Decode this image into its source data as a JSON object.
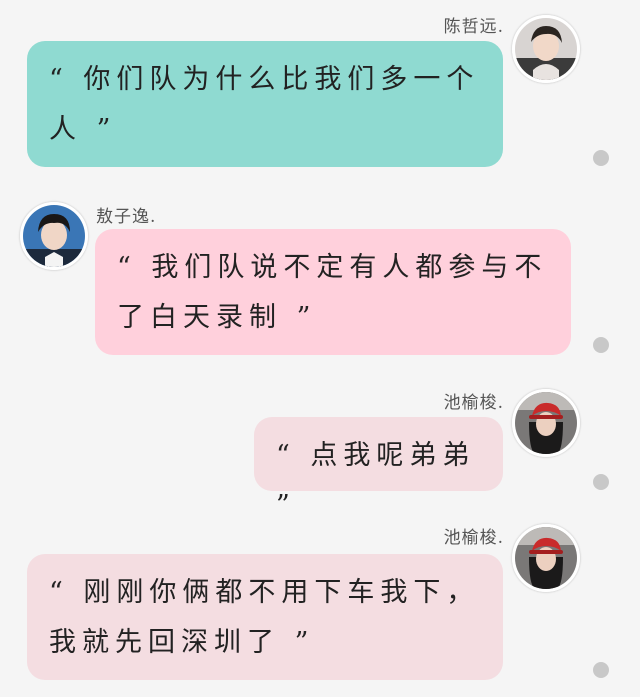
{
  "colors": {
    "background": "#f5f5f5",
    "teal_bubble": "#8fdad1",
    "pink_bubble": "#ffd0dc",
    "light_pink_bubble": "#f4dde1",
    "dot": "#c8c8c8"
  },
  "messages": [
    {
      "sender": "陈哲远.",
      "side": "right",
      "text": "“ 你们队为什么比我们多一个人 ”",
      "avatar_icon": "male-avatar-icon"
    },
    {
      "sender": "敖子逸.",
      "side": "left",
      "text": "“ 我们队说不定有人都参与不了白天录制 ”",
      "avatar_icon": "male-avatar-icon"
    },
    {
      "sender": "池榆梭.",
      "side": "right",
      "text": "“ 点我呢弟弟 ”",
      "avatar_icon": "female-avatar-red-hat-icon"
    },
    {
      "sender": "池榆梭.",
      "side": "right",
      "text": "“ 刚刚你俩都不用下车我下，我就先回深圳了 ”",
      "avatar_icon": "female-avatar-red-hat-icon"
    }
  ]
}
